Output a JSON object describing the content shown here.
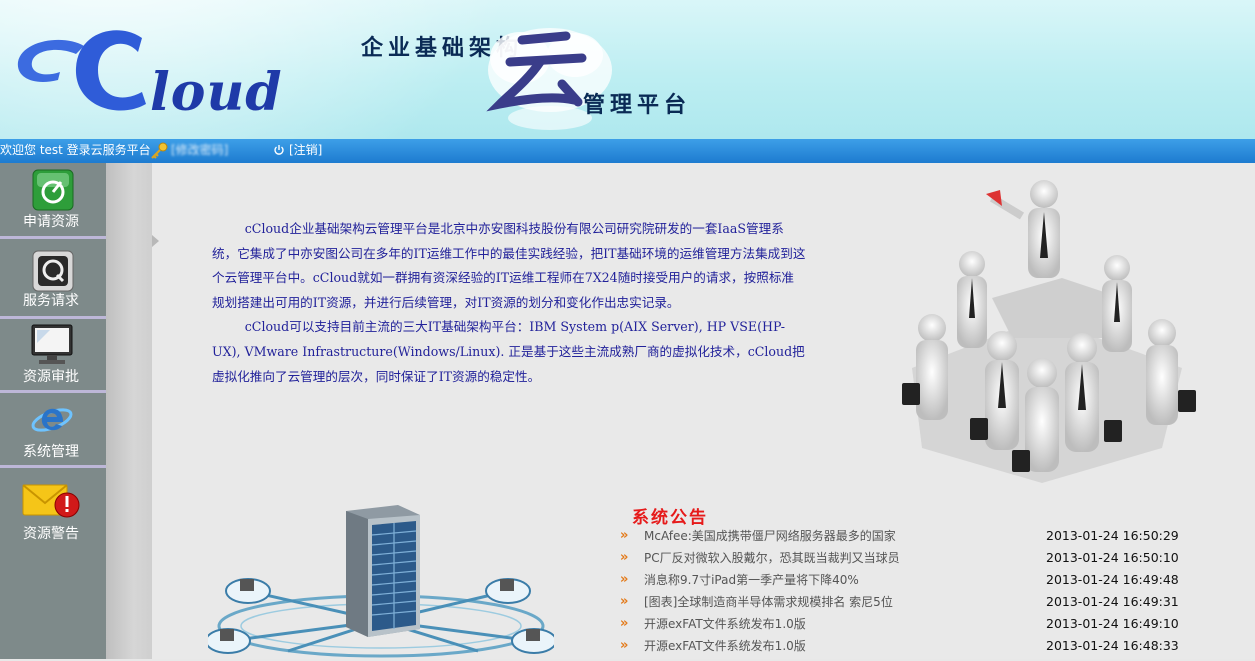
{
  "header": {
    "logo_text": "cCloud",
    "tagline_top": "企业基础架构",
    "tagline_char": "云",
    "tagline_bottom": "管理平台"
  },
  "statusbar": {
    "welcome": "欢迎您 test 登录云服务平台",
    "blurred_text": "[修改密码]",
    "logout_label": "[注销]"
  },
  "sidebar": {
    "items": [
      {
        "label": "申请资源",
        "icon": "apply-resource-icon"
      },
      {
        "label": "服务请求",
        "icon": "service-request-icon"
      },
      {
        "label": "资源审批",
        "icon": "monitor-approval-icon"
      },
      {
        "label": "系统管理",
        "icon": "system-ie-icon"
      },
      {
        "label": "资源警告",
        "icon": "mail-alert-icon"
      }
    ]
  },
  "intro": {
    "paragraph1": "cCloud企业基础架构云管理平台是北京中亦安图科技股份有限公司研究院研发的一套IaaS管理系统，它集成了中亦安图公司在多年的IT运维工作中的最佳实践经验，把IT基础环境的运维管理方法集成到这个云管理平台中。cCloud就如一群拥有资深经验的IT运维工程师在7X24随时接受用户的请求，按照标准规划搭建出可用的IT资源，并进行后续管理，对IT资源的划分和变化作出忠实记录。",
    "paragraph2": "cCloud可以支持目前主流的三大IT基础架构平台：IBM System p(AIX Server), HP VSE(HP-UX), VMware Infrastructure(Windows/Linux). 正是基于这些主流成熟厂商的虚拟化技术，cCloud把虚拟化推向了云管理的层次，同时保证了IT资源的稳定性。"
  },
  "notices": {
    "title": "系统公告",
    "items": [
      {
        "title": "McAfee:美国成携带僵尸网络服务器最多的国家",
        "time": "2013-01-24 16:50:29"
      },
      {
        "title": "PC厂反对微软入股戴尔，恐其既当裁判又当球员",
        "time": "2013-01-24 16:50:10"
      },
      {
        "title": "消息称9.7寸iPad第一季产量将下降40%",
        "time": "2013-01-24 16:49:48"
      },
      {
        "title": "[图表]全球制造商半导体需求规模排名 索尼5位",
        "time": "2013-01-24 16:49:31"
      },
      {
        "title": "开源exFAT文件系统发布1.0版",
        "time": "2013-01-24 16:49:10"
      },
      {
        "title": "开源exFAT文件系统发布1.0版",
        "time": "2013-01-24 16:48:33"
      }
    ]
  },
  "colors": {
    "status_bar": "#1d7bd0",
    "sidebar": "#7e8a8a",
    "notice_title": "#e61a1a",
    "intro_text": "#22229a"
  }
}
